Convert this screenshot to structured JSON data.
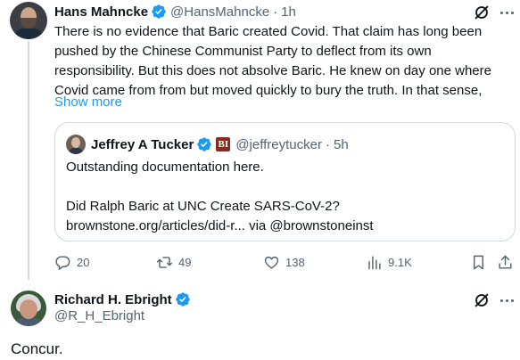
{
  "colors": {
    "accent": "#1d9bf0",
    "muted": "#536471",
    "border": "#cfd9de"
  },
  "tweet": {
    "author_name": "Hans Mahncke",
    "handle": "@HansMahncke",
    "separator": "·",
    "time": "1h",
    "body_lines": [
      "There is no evidence that Baric created Covid. That claim has long been",
      "pushed by the Chinese Communist Party to deflect from its own",
      "responsibility. But this does not absolve Baric. He knew on day one where",
      "Covid came from from but moved quickly to bury the truth. In that sense,"
    ],
    "show_more": "Show more",
    "quote": {
      "author_name": "Jeffrey A Tucker",
      "badge": "BI",
      "handle": "@jeffreytucker",
      "separator": "·",
      "time": "5h",
      "lines": [
        "Outstanding documentation here.",
        "",
        "Did Ralph Baric at UNC Create SARS-CoV-2?",
        "brownstone.org/articles/did-r... via @brownstoneinst"
      ]
    },
    "actions": {
      "replies": "20",
      "reposts": "49",
      "likes": "138",
      "views": "9.1K"
    }
  },
  "reply": {
    "author_name": "Richard H. Ebright",
    "handle": "@R_H_Ebright",
    "text": "Concur."
  }
}
